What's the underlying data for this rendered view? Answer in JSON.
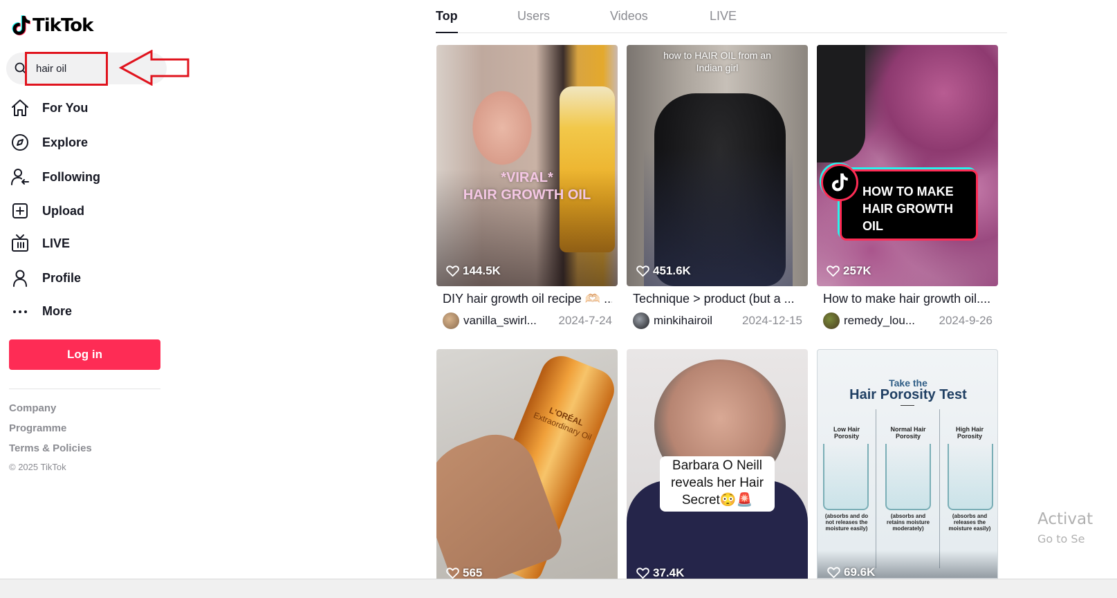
{
  "brand": {
    "name": "TikTok"
  },
  "search": {
    "value": "hair oil"
  },
  "nav": [
    {
      "label": "For You",
      "icon": "home-icon"
    },
    {
      "label": "Explore",
      "icon": "compass-icon"
    },
    {
      "label": "Following",
      "icon": "following-icon"
    },
    {
      "label": "Upload",
      "icon": "upload-icon"
    },
    {
      "label": "LIVE",
      "icon": "live-icon"
    },
    {
      "label": "Profile",
      "icon": "profile-icon"
    },
    {
      "label": "More",
      "icon": "more-icon"
    }
  ],
  "login": {
    "label": "Log in"
  },
  "footer": {
    "links": [
      "Company",
      "Programme",
      "Terms & Policies"
    ],
    "copyright": "© 2025 TikTok"
  },
  "tabs": [
    "Top",
    "Users",
    "Videos",
    "LIVE"
  ],
  "videos": [
    {
      "likes": "144.5K",
      "caption": "DIY hair growth oil recipe 🫶🏻 ...",
      "user": "vanilla_swirl...",
      "date": "2024-7-24",
      "overlay": [
        "*VIRAL*",
        "HAIR GROWTH OIL"
      ]
    },
    {
      "likes": "451.6K",
      "caption": "Technique > product (but a ...",
      "user": "minkihairoil",
      "date": "2024-12-15",
      "overlay": [
        "how to HAIR OIL from an",
        "Indian girl"
      ]
    },
    {
      "likes": "257K",
      "caption": "How to make hair growth oil....",
      "user": "remedy_lou...",
      "date": "2024-9-26",
      "overlay": [
        "HOW TO MAKE",
        "HAIR GROWTH",
        "OIL"
      ]
    },
    {
      "likes": "565",
      "overlay": [
        "L'ORÉAL",
        "Extraordinary Oil"
      ]
    },
    {
      "likes": "37.4K",
      "overlay": [
        "Barbara O Neill",
        "reveals her Hair",
        "Secret😳🚨"
      ]
    },
    {
      "likes": "69.6K",
      "overlay": [
        "Take the",
        "Hair Porosity Test"
      ],
      "porosity": [
        {
          "title": "Low Hair Porosity",
          "note": "(absorbs and do not releases the moisture easily)"
        },
        {
          "title": "Normal Hair Porosity",
          "note": "(absorbs and retains moisture moderately)"
        },
        {
          "title": "High Hair Porosity",
          "note": "(absorbs and releases the moisture easily)"
        }
      ]
    }
  ],
  "watermark": {
    "title": "Activat",
    "subtitle": "Go to Se"
  },
  "colors": {
    "accent": "#fe2c55",
    "annotation": "#e0141e",
    "muted": "#8a8b91"
  }
}
